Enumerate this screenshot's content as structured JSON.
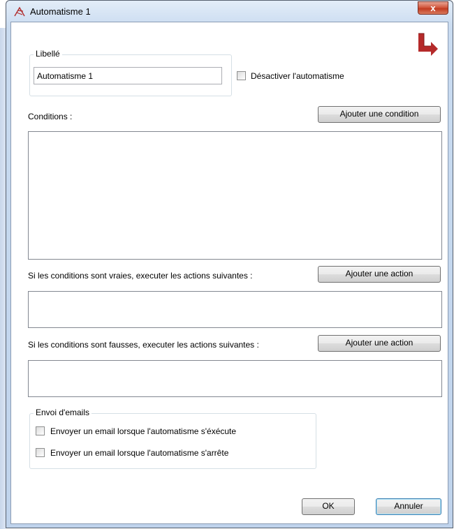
{
  "window": {
    "title": "Automatisme 1",
    "close_glyph": "x"
  },
  "libelle_group": {
    "legend": "Libellé",
    "value": "Automatisme 1"
  },
  "disable_checkbox": {
    "label": "Désactiver l'automatisme",
    "checked": false
  },
  "conditions": {
    "label": "Conditions :",
    "add_button": "Ajouter une condition"
  },
  "true_actions": {
    "label": "Si les conditions sont vraies, executer les actions suivantes :",
    "add_button": "Ajouter une action"
  },
  "false_actions": {
    "label": "Si les conditions sont fausses, executer les actions suivantes :",
    "add_button": "Ajouter une action"
  },
  "emails_group": {
    "legend": "Envoi d'emails",
    "option_run": {
      "label": "Envoyer un email lorsque l'automatisme s'éxécute",
      "checked": false
    },
    "option_stop": {
      "label": "Envoyer un email lorsque l'automatisme s'arrête",
      "checked": false
    }
  },
  "footer": {
    "ok_label": "OK",
    "cancel_label": "Annuler"
  },
  "icons": {
    "app": "automation-icon",
    "logo": "red-arrow-logo-icon"
  },
  "colors": {
    "logo_red": "#b52a2a",
    "close_red": "#c94a30"
  }
}
